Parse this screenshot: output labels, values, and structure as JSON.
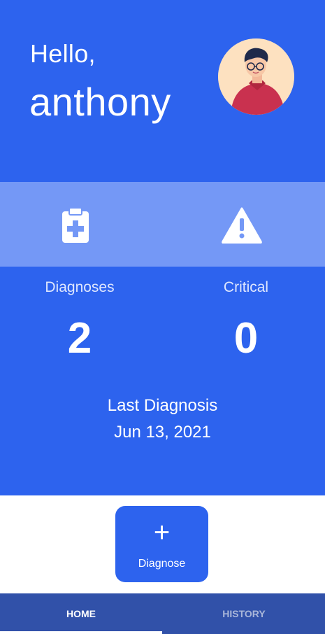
{
  "header": {
    "greeting": "Hello,",
    "username": "anthony",
    "avatar_icon": "user-avatar-illustration"
  },
  "stats": {
    "icons": [
      "clipboard-medical-icon",
      "warning-triangle-icon"
    ],
    "diagnoses_label": "Diagnoses",
    "diagnoses_value": "2",
    "critical_label": "Critical",
    "critical_value": "0"
  },
  "last_diagnosis": {
    "title": "Last Diagnosis",
    "date": "Jun 13, 2021"
  },
  "action": {
    "icon": "+",
    "label": "Diagnose"
  },
  "nav": {
    "tabs": [
      {
        "label": "HOME",
        "active": true
      },
      {
        "label": "HISTORY",
        "active": false
      }
    ]
  },
  "colors": {
    "primary": "#2d63ee",
    "band": "#7498f6",
    "nav": "#3151a9"
  }
}
